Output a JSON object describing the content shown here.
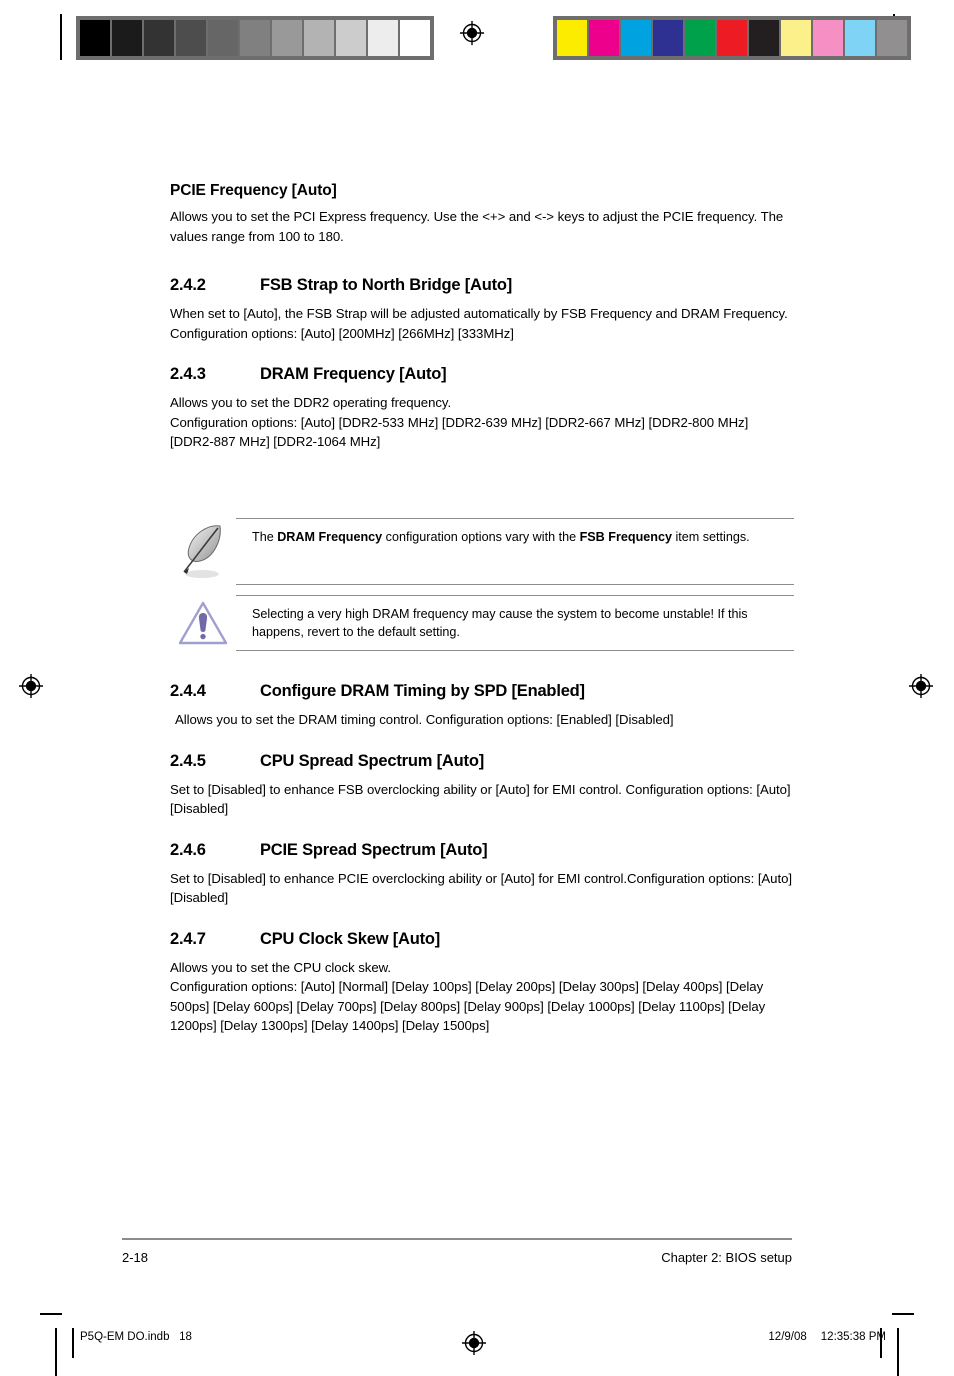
{
  "document": {
    "page_label": "2-18",
    "chapter_label": "Chapter 2: BIOS setup",
    "print_file": "P5Q-EM DO.indb",
    "print_page_number": "18",
    "print_date": "12/9/08",
    "print_time": "12:35:38 PM"
  },
  "sections": {
    "pcie_frequency": {
      "heading": "PCIE Frequency [Auto]",
      "body": "Allows you to set the PCI Express frequency. Use the <+> and <-> keys to adjust the PCIE frequency. The values range from 100 to 180."
    },
    "fsb_strap": {
      "number": "2.4.2",
      "title": "FSB Strap to North Bridge [Auto]",
      "body": "When set to [Auto], the FSB Strap will be adjusted automatically by FSB Frequency and DRAM Frequency. Configuration options: [Auto] [200MHz] [266MHz] [333MHz]"
    },
    "dram_frequency": {
      "number": "2.4.3",
      "title": "DRAM Frequency [Auto]",
      "body_line1": "Allows you to set the DDR2 operating frequency.",
      "body_line2": "Configuration options: [Auto] [DDR2-533 MHz] [DDR2-639 MHz] [DDR2-667 MHz]  [DDR2-800 MHz] [DDR2-887 MHz] [DDR2-1064 MHz]"
    },
    "configure_dram_timing": {
      "number": "2.4.4",
      "title": "Configure DRAM Timing by SPD [Enabled]",
      "body": "Allows you to set the DRAM timing control. Configuration options: [Enabled] [Disabled]"
    },
    "cpu_spread_spectrum": {
      "number": "2.4.5",
      "title": "CPU Spread Spectrum [Auto]",
      "body": "Set to [Disabled] to enhance FSB overclocking ability or [Auto] for EMI control. Configuration options: [Auto] [Disabled]"
    },
    "pcie_spread_spectrum": {
      "number": "2.4.6",
      "title": "PCIE Spread Spectrum [Auto]",
      "body": "Set to [Disabled] to enhance PCIE overclocking ability or [Auto] for EMI control.Configuration options: [Auto] [Disabled]"
    },
    "cpu_clock_skew": {
      "number": "2.4.7",
      "title": "CPU Clock Skew [Auto]",
      "body_line1": "Allows you to set the CPU clock skew.",
      "body_line2": "Configuration options: [Auto] [Normal] [Delay 100ps] [Delay 200ps] [Delay 300ps] [Delay 400ps] [Delay 500ps] [Delay 600ps] [Delay 700ps] [Delay 800ps] [Delay 900ps] [Delay 1000ps] [Delay 1100ps] [Delay 1200ps] [Delay 1300ps] [Delay 1400ps] [Delay 1500ps]"
    }
  },
  "callouts": {
    "note": {
      "icon": "quill-pen-icon",
      "text_part1": "The ",
      "bold1": "DRAM Frequency",
      "text_part2": " configuration options vary with the ",
      "bold2": "FSB Frequency",
      "text_part3": " item settings."
    },
    "warning": {
      "icon": "warning-triangle-icon",
      "text": "Selecting a very high DRAM frequency may cause the system to become unstable! If this happens, revert to the default setting."
    }
  },
  "calibration": {
    "grayscale_swatches": [
      "#000000",
      "#1b1b1b",
      "#333333",
      "#4d4d4d",
      "#666666",
      "#808080",
      "#999999",
      "#b3b3b3",
      "#cccccc",
      "#ededed",
      "#ffffff"
    ],
    "color_swatches": [
      "#fced00",
      "#ec008c",
      "#00a3e0",
      "#2e3192",
      "#00a14b",
      "#ed1c24",
      "#231f20",
      "#fcf08a",
      "#f68fc4",
      "#7fd4f5",
      "#918f8f"
    ],
    "strip_border_color": "#6e6e6e"
  }
}
